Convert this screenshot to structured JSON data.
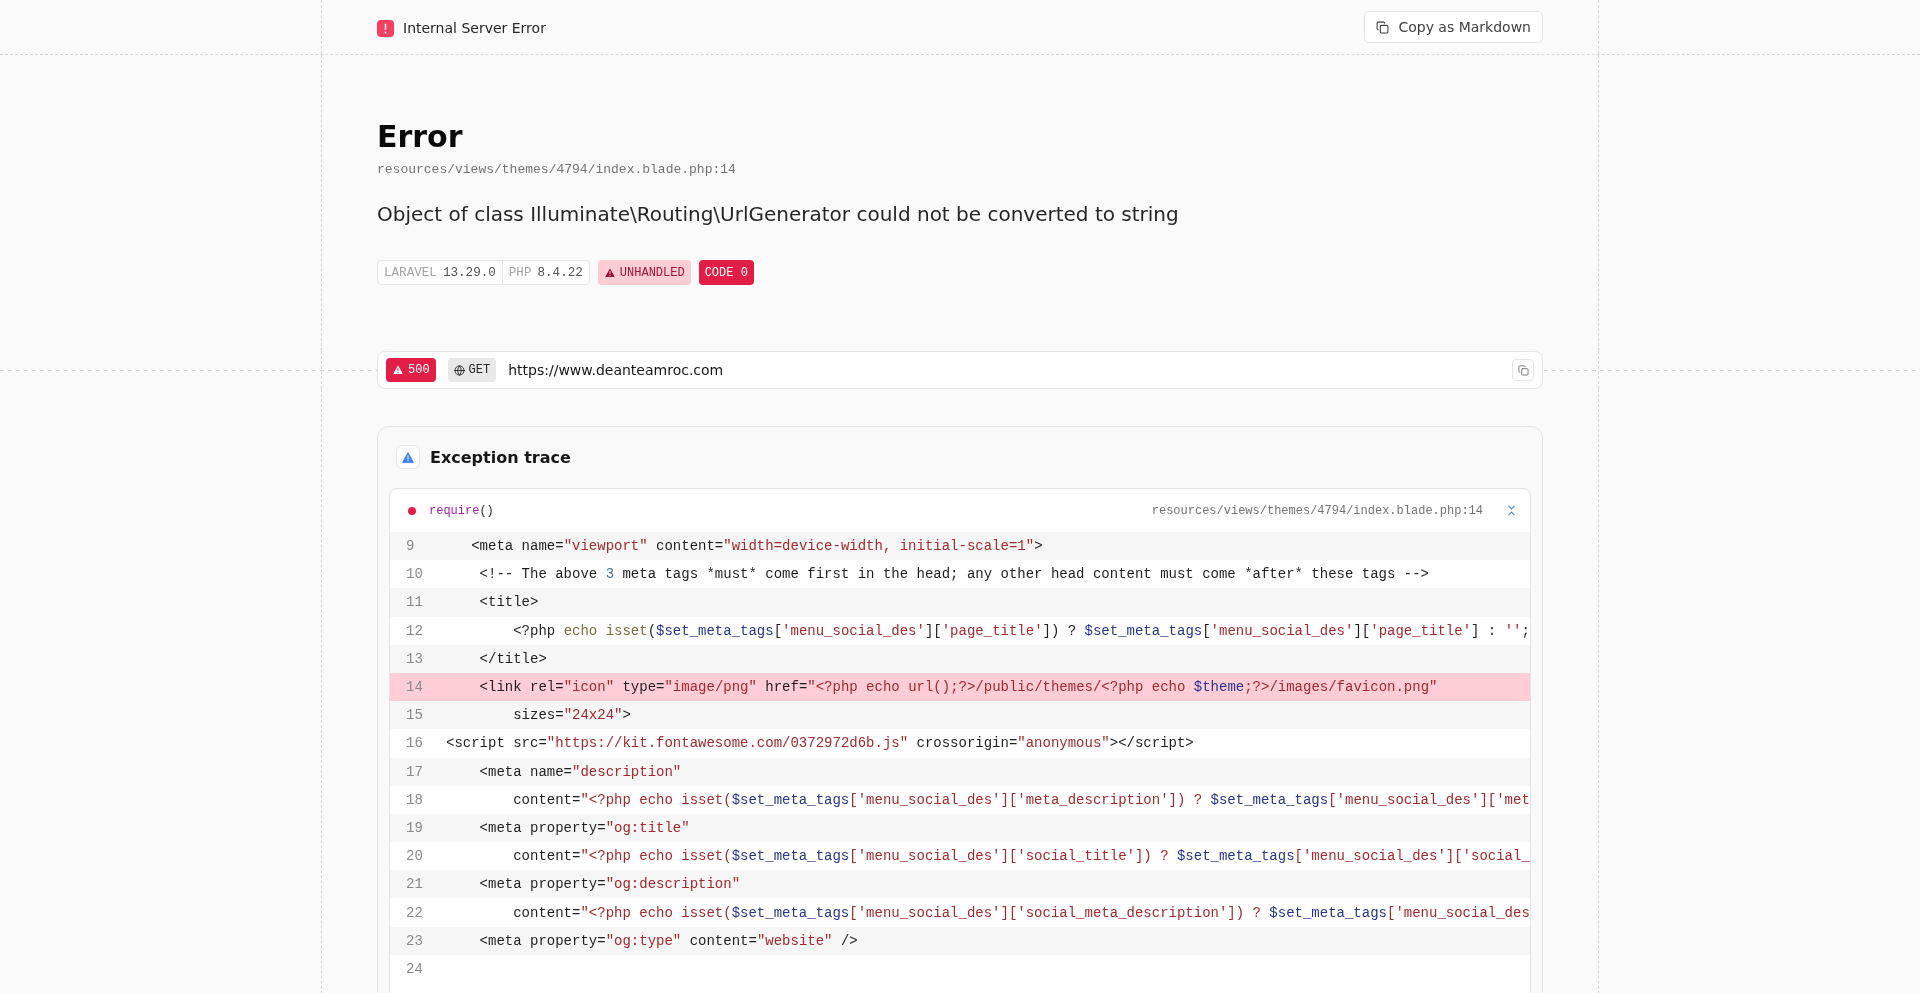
{
  "header": {
    "title": "Internal Server Error",
    "copy_button": "Copy as Markdown"
  },
  "error": {
    "title": "Error",
    "location": "resources/views/themes/4794/index.blade.php:14",
    "message": "Object of class Illuminate\\Routing\\UrlGenerator could not be converted to string",
    "versions": [
      {
        "name": "LARAVEL",
        "value": "13.29.0"
      },
      {
        "name": "PHP",
        "value": "8.4.22"
      }
    ],
    "badges": [
      {
        "kind": "unhandled",
        "label": "UNHANDLED"
      },
      {
        "kind": "code",
        "label": "CODE 0"
      }
    ]
  },
  "request": {
    "status": "500",
    "method": "GET",
    "url": "https://www.deanteamroc.com"
  },
  "trace": {
    "title": "Exception trace",
    "frames": [
      {
        "function": "require",
        "args": "()",
        "file": "resources/views/themes/4794/index.blade.php:14",
        "expanded": true,
        "lines": [
          {
            "number": "9",
            "highlighted": false,
            "tokens": [
              {
                "kind": "plain",
                "text": "   <meta name="
              },
              {
                "kind": "string",
                "text": "\"viewport\""
              },
              {
                "kind": "plain",
                "text": " content="
              },
              {
                "kind": "string",
                "text": "\"width=device-width, initial-scale=1\""
              },
              {
                "kind": "plain",
                "text": ">"
              }
            ]
          },
          {
            "number": "10",
            "highlighted": false,
            "tokens": [
              {
                "kind": "plain",
                "text": "    <!-- The above "
              },
              {
                "kind": "number",
                "text": "3"
              },
              {
                "kind": "plain",
                "text": " meta tags *must* come first in the head; any other head content must come *after* these tags -->"
              }
            ]
          },
          {
            "number": "11",
            "highlighted": false,
            "tokens": [
              {
                "kind": "plain",
                "text": "    <title>"
              }
            ]
          },
          {
            "number": "12",
            "highlighted": false,
            "tokens": [
              {
                "kind": "plain",
                "text": "        <?php "
              },
              {
                "kind": "keyword",
                "text": "echo isset"
              },
              {
                "kind": "plain",
                "text": "("
              },
              {
                "kind": "variable",
                "text": "$set_meta_tags"
              },
              {
                "kind": "plain",
                "text": "["
              },
              {
                "kind": "string",
                "text": "'menu_social_des'"
              },
              {
                "kind": "plain",
                "text": "]["
              },
              {
                "kind": "string",
                "text": "'page_title'"
              },
              {
                "kind": "plain",
                "text": "]) ? "
              },
              {
                "kind": "variable",
                "text": "$set_meta_tags"
              },
              {
                "kind": "plain",
                "text": "["
              },
              {
                "kind": "string",
                "text": "'menu_social_des'"
              },
              {
                "kind": "plain",
                "text": "]["
              },
              {
                "kind": "string",
                "text": "'page_title'"
              },
              {
                "kind": "plain",
                "text": "] : "
              },
              {
                "kind": "string",
                "text": "''"
              },
              {
                "kind": "plain",
                "text": ";"
              }
            ]
          },
          {
            "number": "13",
            "highlighted": false,
            "tokens": [
              {
                "kind": "plain",
                "text": "    </title>"
              }
            ]
          },
          {
            "number": "14",
            "highlighted": true,
            "tokens": [
              {
                "kind": "plain",
                "text": "    <link rel="
              },
              {
                "kind": "string",
                "text": "\"icon\""
              },
              {
                "kind": "plain",
                "text": " type="
              },
              {
                "kind": "string",
                "text": "\"image/png\""
              },
              {
                "kind": "plain",
                "text": " href="
              },
              {
                "kind": "string",
                "text": "\"<?php echo url();?>/public/themes/<?php echo "
              },
              {
                "kind": "variable",
                "text": "$theme"
              },
              {
                "kind": "string",
                "text": ";?>/images/favicon.png\""
              }
            ]
          },
          {
            "number": "15",
            "highlighted": false,
            "tokens": [
              {
                "kind": "plain",
                "text": "        sizes="
              },
              {
                "kind": "string",
                "text": "\"24x24\""
              },
              {
                "kind": "plain",
                "text": ">"
              }
            ]
          },
          {
            "number": "16",
            "highlighted": false,
            "tokens": [
              {
                "kind": "plain",
                "text": "<script src="
              },
              {
                "kind": "string",
                "text": "\"https://kit.fontawesome.com/0372972d6b.js\""
              },
              {
                "kind": "plain",
                "text": " crossorigin="
              },
              {
                "kind": "string",
                "text": "\"anonymous\""
              },
              {
                "kind": "plain",
                "text": "></script>"
              }
            ]
          },
          {
            "number": "17",
            "highlighted": false,
            "tokens": [
              {
                "kind": "plain",
                "text": "    <meta name="
              },
              {
                "kind": "string",
                "text": "\"description\""
              }
            ]
          },
          {
            "number": "18",
            "highlighted": false,
            "tokens": [
              {
                "kind": "plain",
                "text": "        content="
              },
              {
                "kind": "string",
                "text": "\"<?php echo isset("
              },
              {
                "kind": "variable",
                "text": "$set_meta_tags"
              },
              {
                "kind": "string",
                "text": "['menu_social_des']['meta_description']) ? "
              },
              {
                "kind": "variable",
                "text": "$set_meta_tags"
              },
              {
                "kind": "string",
                "text": "['menu_social_des']['met"
              }
            ]
          },
          {
            "number": "19",
            "highlighted": false,
            "tokens": [
              {
                "kind": "plain",
                "text": "    <meta property="
              },
              {
                "kind": "string",
                "text": "\"og:title\""
              }
            ]
          },
          {
            "number": "20",
            "highlighted": false,
            "tokens": [
              {
                "kind": "plain",
                "text": "        content="
              },
              {
                "kind": "string",
                "text": "\"<?php echo isset("
              },
              {
                "kind": "variable",
                "text": "$set_meta_tags"
              },
              {
                "kind": "string",
                "text": "['menu_social_des']['social_title']) ? "
              },
              {
                "kind": "variable",
                "text": "$set_meta_tags"
              },
              {
                "kind": "string",
                "text": "['menu_social_des']['social_"
              }
            ]
          },
          {
            "number": "21",
            "highlighted": false,
            "tokens": [
              {
                "kind": "plain",
                "text": "    <meta property="
              },
              {
                "kind": "string",
                "text": "\"og:description\""
              }
            ]
          },
          {
            "number": "22",
            "highlighted": false,
            "tokens": [
              {
                "kind": "plain",
                "text": "        content="
              },
              {
                "kind": "string",
                "text": "\"<?php echo isset("
              },
              {
                "kind": "variable",
                "text": "$set_meta_tags"
              },
              {
                "kind": "string",
                "text": "['menu_social_des']['social_meta_description']) ? "
              },
              {
                "kind": "variable",
                "text": "$set_meta_tags"
              },
              {
                "kind": "string",
                "text": "['menu_social_des"
              }
            ]
          },
          {
            "number": "23",
            "highlighted": false,
            "tokens": [
              {
                "kind": "plain",
                "text": "    <meta property="
              },
              {
                "kind": "string",
                "text": "\"og:type\""
              },
              {
                "kind": "plain",
                "text": " content="
              },
              {
                "kind": "string",
                "text": "\"website\""
              },
              {
                "kind": "plain",
                "text": " />"
              }
            ]
          },
          {
            "number": "24",
            "highlighted": false
          }
        ]
      }
    ]
  }
}
